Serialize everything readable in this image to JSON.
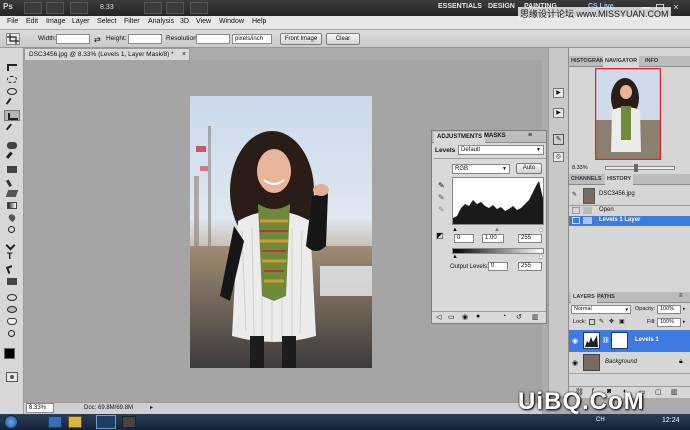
{
  "app": {
    "logo": "Ps",
    "zoom": "8.33",
    "workspaces": [
      "ESSENTIALS",
      "DESIGN",
      "PAINTING"
    ],
    "cs_live": "CS Live"
  },
  "menu": [
    "File",
    "Edit",
    "Image",
    "Layer",
    "Select",
    "Filter",
    "Analysis",
    "3D",
    "View",
    "Window",
    "Help"
  ],
  "watermark_top": "思缘设计论坛 www.MISSYUAN.COM",
  "options": {
    "width_label": "Width:",
    "height_label": "Height:",
    "resolution_label": "Resolution:",
    "resolution_unit": "pixels/inch",
    "front_image": "Front Image",
    "clear": "Clear"
  },
  "document": {
    "tab_title": "DSC3456.jpg @ 8.33% (Levels 1, Layer Mask/8) *"
  },
  "adjustments": {
    "tabs": [
      "ADJUSTMENTS",
      "MASKS"
    ],
    "active_tab": 0,
    "levels_label": "Levels",
    "preset": "Default",
    "channel": "RGB",
    "auto": "Auto",
    "input_black": "0",
    "input_gamma": "1.00",
    "input_white": "255",
    "output_label": "Output Levels:",
    "output_black": "0",
    "output_white": "255"
  },
  "dock": {
    "top_tabs": [
      "HISTOGRAM",
      "NAVIGATOR",
      "INFO"
    ],
    "top_active": 1,
    "nav_zoom": "8.33%",
    "mid_tabs": [
      "CHANNELS",
      "HISTORY"
    ],
    "mid_active": 1,
    "history_snapshot": "DSC3456.jpg",
    "history_items": [
      "Open",
      "Levels 1 Layer"
    ],
    "history_selected": 1,
    "layers_tabs": [
      "LAYERS",
      "PATHS"
    ],
    "layers_active": 0,
    "blend_mode": "Normal",
    "opacity_label": "Opacity:",
    "opacity": "100%",
    "lock_label": "Lock:",
    "fill_label": "Fill:",
    "fill": "100%",
    "layers": [
      {
        "name": "Levels 1",
        "selected": true,
        "italic": false
      },
      {
        "name": "Background",
        "selected": false,
        "italic": true
      }
    ]
  },
  "status": {
    "zoom": "8.33%",
    "doc": "Doc: 69.8M/69.8M"
  },
  "taskbar": {
    "lang": "CH",
    "time": "12:24"
  },
  "watermark_bottom": "UiBQ.CoM",
  "colors": {
    "accent_selected": "#3d7be0",
    "app_bar": "#2e2e2e",
    "canvas_bg": "#a5a5a5",
    "nav_frame": "#e02828"
  }
}
